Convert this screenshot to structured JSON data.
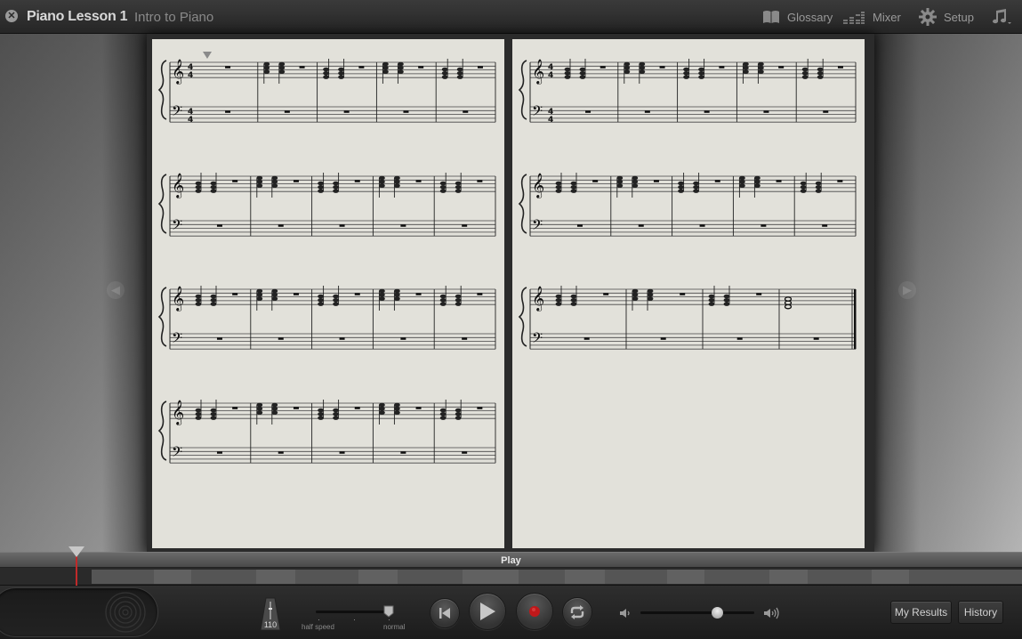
{
  "window": {
    "title": "Piano Lesson 1",
    "subtitle": "Intro to Piano"
  },
  "toolbar": {
    "glossary_label": "Glossary",
    "mixer_label": "Mixer",
    "setup_label": "Setup"
  },
  "score": {
    "time_signature": "4/4",
    "left_page_systems": 4,
    "right_page_systems": 3,
    "measures_per_system": [
      5,
      5,
      5,
      5,
      5,
      5,
      4
    ]
  },
  "playback": {
    "play_label": "Play",
    "tempo": "110",
    "speed_min_label": "half speed",
    "speed_max_label": "normal",
    "speed_value_fraction": 1.0,
    "volume_fraction": 0.67
  },
  "buttons": {
    "my_results_label": "My Results",
    "history_label": "History"
  },
  "colors": {
    "record": "#c0181a",
    "playhead": "#c02a2a",
    "paper": "#e2e1da"
  }
}
